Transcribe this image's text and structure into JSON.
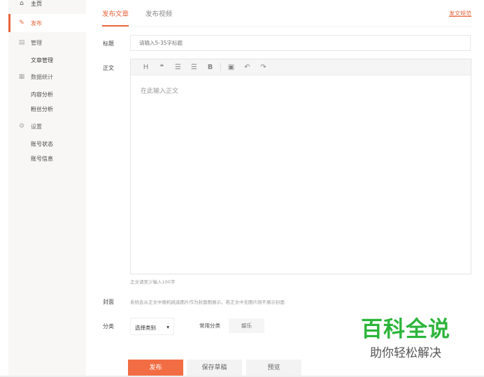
{
  "sidebar": {
    "items": [
      {
        "label": "主页",
        "icon": "home-icon"
      },
      {
        "label": "发布",
        "icon": "edit-icon"
      },
      {
        "label": "管理",
        "icon": "manage-icon"
      },
      {
        "label": "文章管理"
      },
      {
        "label": "数据统计",
        "icon": "calendar-icon"
      },
      {
        "label": "内容分析"
      },
      {
        "label": "粉丝分析"
      },
      {
        "label": "设置",
        "icon": "gear-icon"
      },
      {
        "label": "账号状态"
      },
      {
        "label": "账号信息"
      }
    ]
  },
  "tabs": [
    {
      "label": "发布文章"
    },
    {
      "label": "发布视频"
    }
  ],
  "rules_link": "发文规范",
  "form": {
    "title_label": "标题",
    "title_placeholder": "请输入5-35字标题",
    "body_label": "正文",
    "body_placeholder": "在此输入正文",
    "toolbar": [
      "H",
      "❝",
      "☰",
      "☰",
      "B",
      "▣",
      "↶",
      "↷"
    ],
    "body_hint": "正文请至少输入100字",
    "cover_label": "封面",
    "cover_hint": "系统会从正文中随机挑选图片作为封面图展示，若正文中无图片则不展示封面",
    "category_label": "分类",
    "category_select": "选择类别",
    "common_label": "常用分类",
    "common_chip": "娱乐"
  },
  "buttons": {
    "publish": "发布",
    "save_draft": "保存草稿",
    "preview": "预览"
  },
  "watermark": {
    "line1": "百科全说",
    "line2": "助你轻松解决"
  },
  "colors": {
    "accent": "#e8653a",
    "primary_button": "#f26d44",
    "watermark": "#2cb53b"
  }
}
